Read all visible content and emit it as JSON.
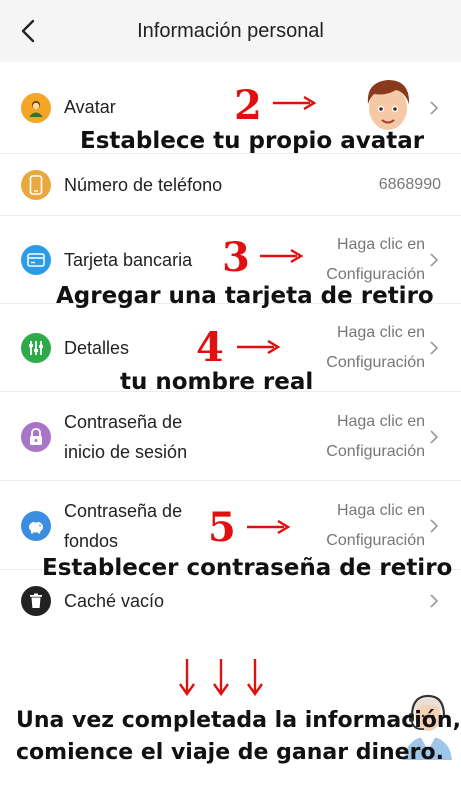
{
  "header": {
    "title": "Información personal",
    "back_icon": "chevron-left-icon"
  },
  "rows": {
    "avatar": {
      "label": "Avatar",
      "icon": "user-icon",
      "icon_color": "#f2a623"
    },
    "phone": {
      "label": "Número de teléfono",
      "value": "6868990",
      "icon": "phone-icon",
      "icon_color": "#e8a93f"
    },
    "bank": {
      "label": "Tarjeta bancaria",
      "value_line1": "Haga clic en",
      "value_line2": "Configuración",
      "icon": "credit-card-icon",
      "icon_color": "#2c9ce8"
    },
    "details": {
      "label": "Detalles",
      "value_line1": "Haga clic en",
      "value_line2": "Configuración",
      "icon": "sliders-icon",
      "icon_color": "#2daa4a"
    },
    "login_password": {
      "label_line1": "Contraseña de",
      "label_line2": "inicio de sesión",
      "value_line1": "Haga clic en",
      "value_line2": "Configuración",
      "icon": "lock-icon",
      "icon_color": "#a875c8"
    },
    "fund_password": {
      "label_line1": "Contraseña de",
      "label_line2": "fondos",
      "value_line1": "Haga clic en",
      "value_line2": "Configuración",
      "icon": "piggy-bank-icon",
      "icon_color": "#3b8de0"
    },
    "cache": {
      "label": "Caché vacío",
      "icon": "trash-icon",
      "icon_color": "#222222"
    }
  },
  "annotations": {
    "step2": {
      "number": "2",
      "text": "Establece tu propio avatar"
    },
    "step3": {
      "number": "3",
      "text": "Agregar una tarjeta de retiro"
    },
    "step4": {
      "number": "4",
      "text": "tu nombre real"
    },
    "step5": {
      "number": "5",
      "text": "Establecer contraseña de retiro"
    },
    "footer_line1": "Una vez completada la información,",
    "footer_line2": "comience el viaje de ganar dinero."
  },
  "colors": {
    "accent_red": "#e01010",
    "header_bg": "#f5f5f5"
  }
}
